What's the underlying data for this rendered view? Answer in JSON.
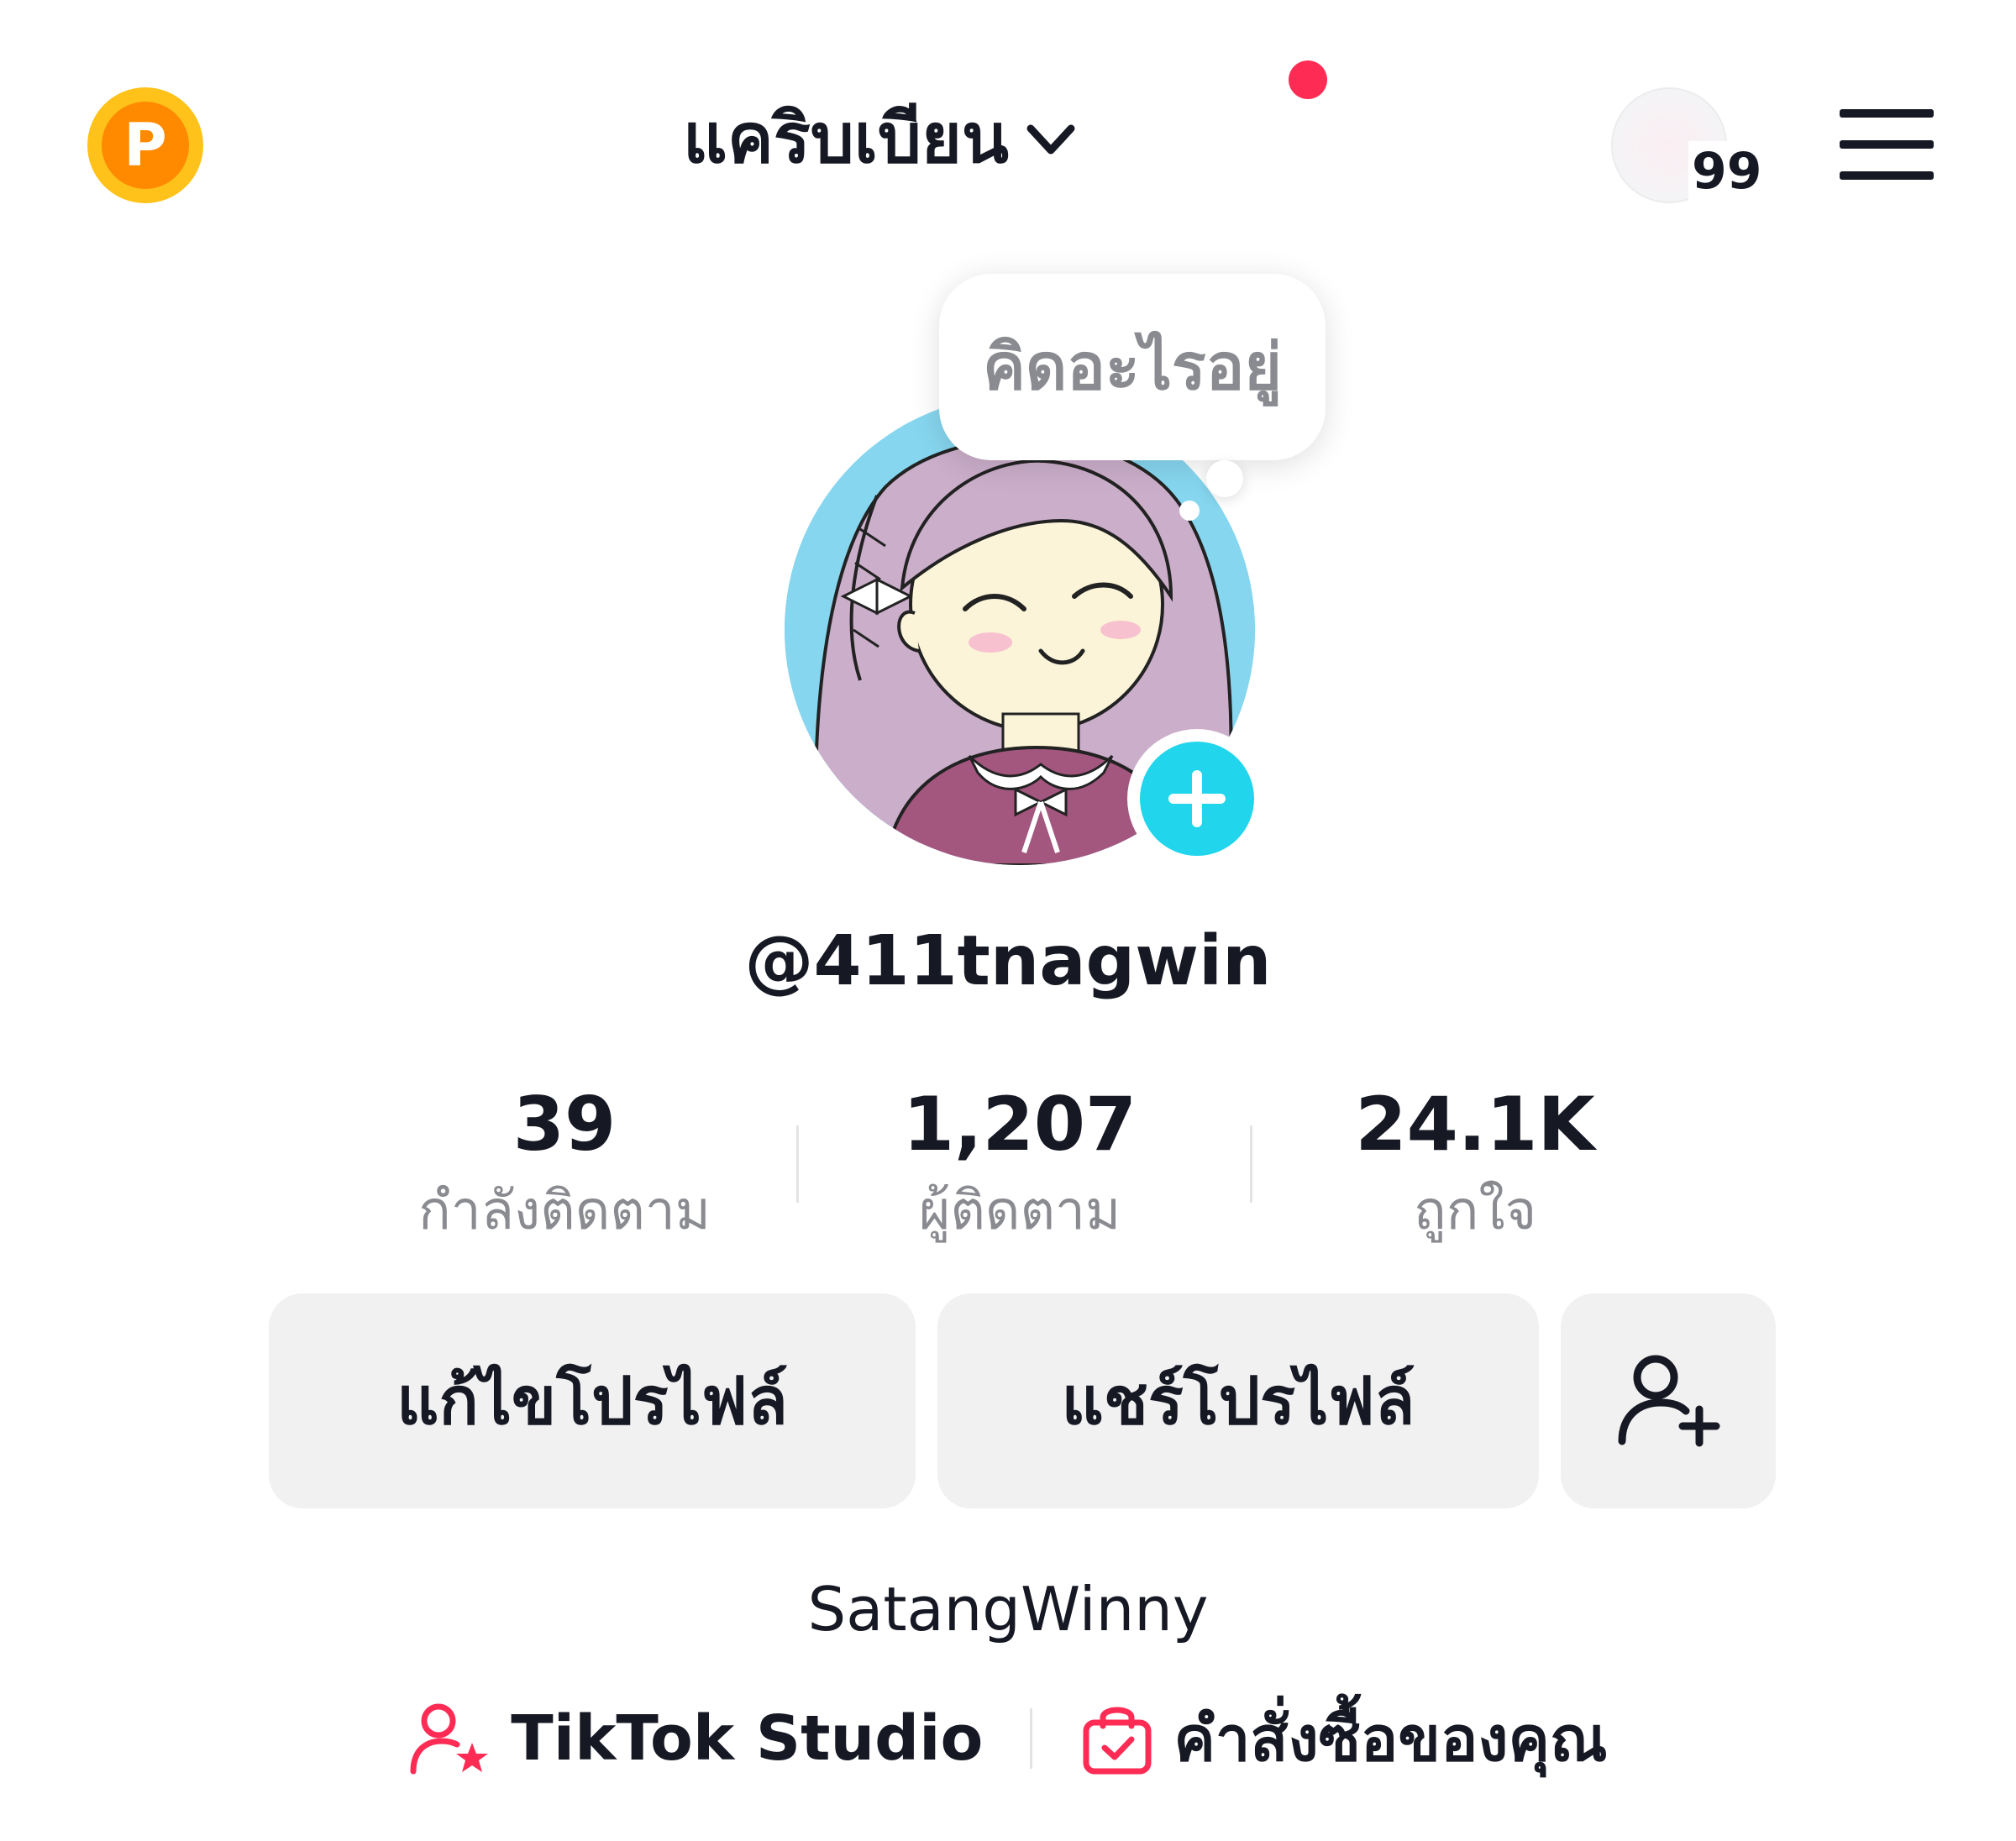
{
  "header": {
    "account_name": "แคริบเบียน",
    "coin_letter": "P",
    "story_count": "99"
  },
  "profile": {
    "thought_placeholder": "คิดอะไรอยู่",
    "username": "@411tnagwin",
    "nickname": "SatangWinny"
  },
  "stats": [
    {
      "value": "39",
      "label": "กำลังติดตาม"
    },
    {
      "value": "1,207",
      "label": "ผู้ติดตาม"
    },
    {
      "value": "24.1K",
      "label": "ถูกใจ"
    }
  ],
  "actions": {
    "edit_profile": "แก้ไขโปรไฟล์",
    "share_profile": "แชร์โปรไฟล์"
  },
  "links": {
    "studio": "TikTok Studio",
    "orders": "คำสั่งซื้อของคุณ"
  },
  "colors": {
    "accent_red": "#fe2c55",
    "accent_cyan": "#20d5ec",
    "coin_gold": "#ffc21a",
    "coin_orange": "#ff8a00",
    "button_bg": "#f1f1f2",
    "secondary_text": "#8a8b91"
  },
  "icons": {
    "coin": "p-coin-icon",
    "chevron": "chevron-down-icon",
    "menu": "hamburger-menu-icon",
    "add_friend": "add-friend-icon",
    "studio": "creator-star-icon",
    "orders": "shopping-bag-icon",
    "add_story": "plus-icon"
  }
}
